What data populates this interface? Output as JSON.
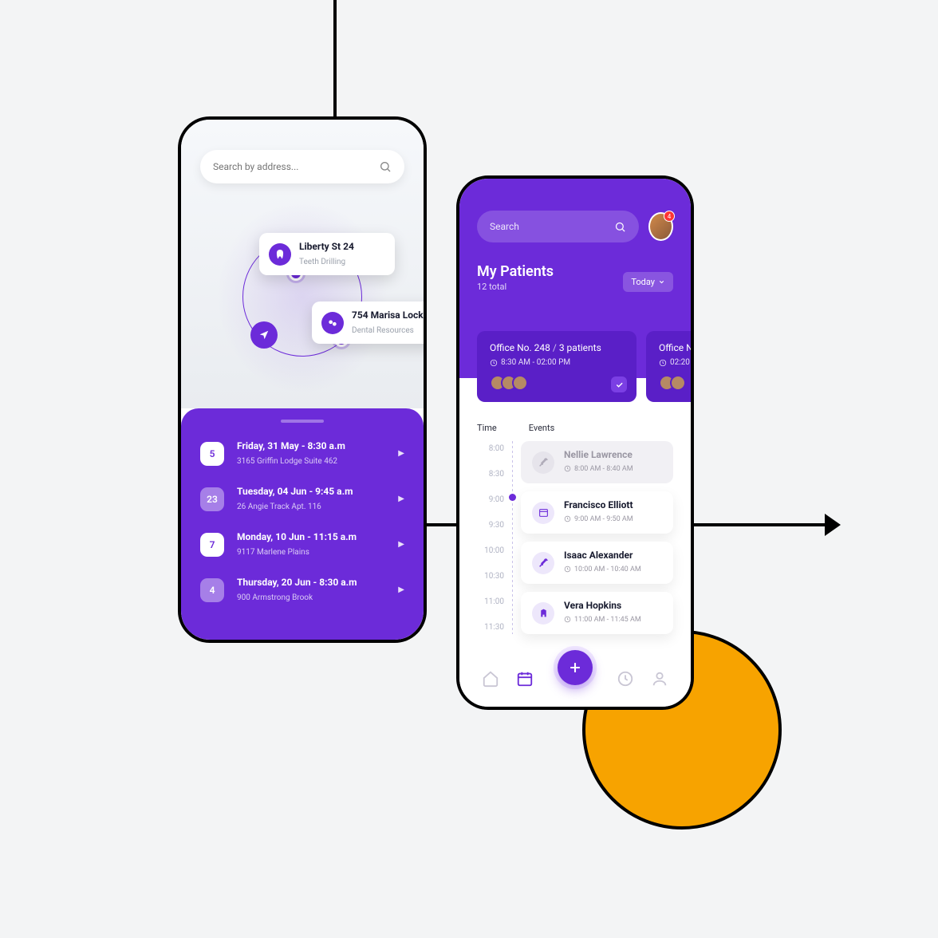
{
  "colors": {
    "accent": "#6c2bd9",
    "accent_dark": "#5a1fc7",
    "orange": "#f7a300"
  },
  "phone1": {
    "search": {
      "placeholder": "Search by address..."
    },
    "callouts": [
      {
        "icon": "tooth-icon",
        "title": "Liberty St 24",
        "sub": "Teeth Drilling"
      },
      {
        "icon": "pills-icon",
        "title": "754 Marisa Lock",
        "sub": "Dental Resources"
      }
    ],
    "appointments": [
      {
        "day": "5",
        "title": "Friday, 31 May - 8:30 a.m",
        "sub": "3165 Griffin Lodge Suite 462",
        "dim": false
      },
      {
        "day": "23",
        "title": "Tuesday, 04 Jun - 9:45 a.m",
        "sub": "26 Angie Track Apt. 116",
        "dim": true
      },
      {
        "day": "7",
        "title": "Monday, 10 Jun - 11:15 a.m",
        "sub": "9117 Marlene Plains",
        "dim": false
      },
      {
        "day": "4",
        "title": "Thursday, 20 Jun - 8:30 a.m",
        "sub": "900 Armstrong Brook",
        "dim": true
      }
    ]
  },
  "phone2": {
    "search": {
      "placeholder": "Search"
    },
    "avatar_badge": "4",
    "title": "My Patients",
    "subtitle": "12 total",
    "filter": "Today",
    "offices": [
      {
        "name": "Office No. 248",
        "patients": "3 patients",
        "time": "8:30 AM - 02:00 PM"
      },
      {
        "name": "Office N",
        "patients": "",
        "time": "02:20"
      }
    ],
    "col_time": "Time",
    "col_events": "Events",
    "time_labels": [
      "8:00",
      "8:30",
      "9:00",
      "9:30",
      "10:00",
      "10:30",
      "11:00",
      "11:30"
    ],
    "events": [
      {
        "name": "Nellie Lawrence",
        "time": "8:00 AM - 8:40 AM",
        "state": "past",
        "icon": "syringe-icon"
      },
      {
        "name": "Francisco Elliott",
        "time": "9:00 AM - 9:50 AM",
        "state": "cur",
        "icon": "calendar-icon"
      },
      {
        "name": "Isaac Alexander",
        "time": "10:00 AM - 10:40 AM",
        "state": "cur",
        "icon": "syringe-icon"
      },
      {
        "name": "Vera Hopkins",
        "time": "11:00 AM - 11:45 AM",
        "state": "cur",
        "icon": "building-icon"
      }
    ]
  }
}
